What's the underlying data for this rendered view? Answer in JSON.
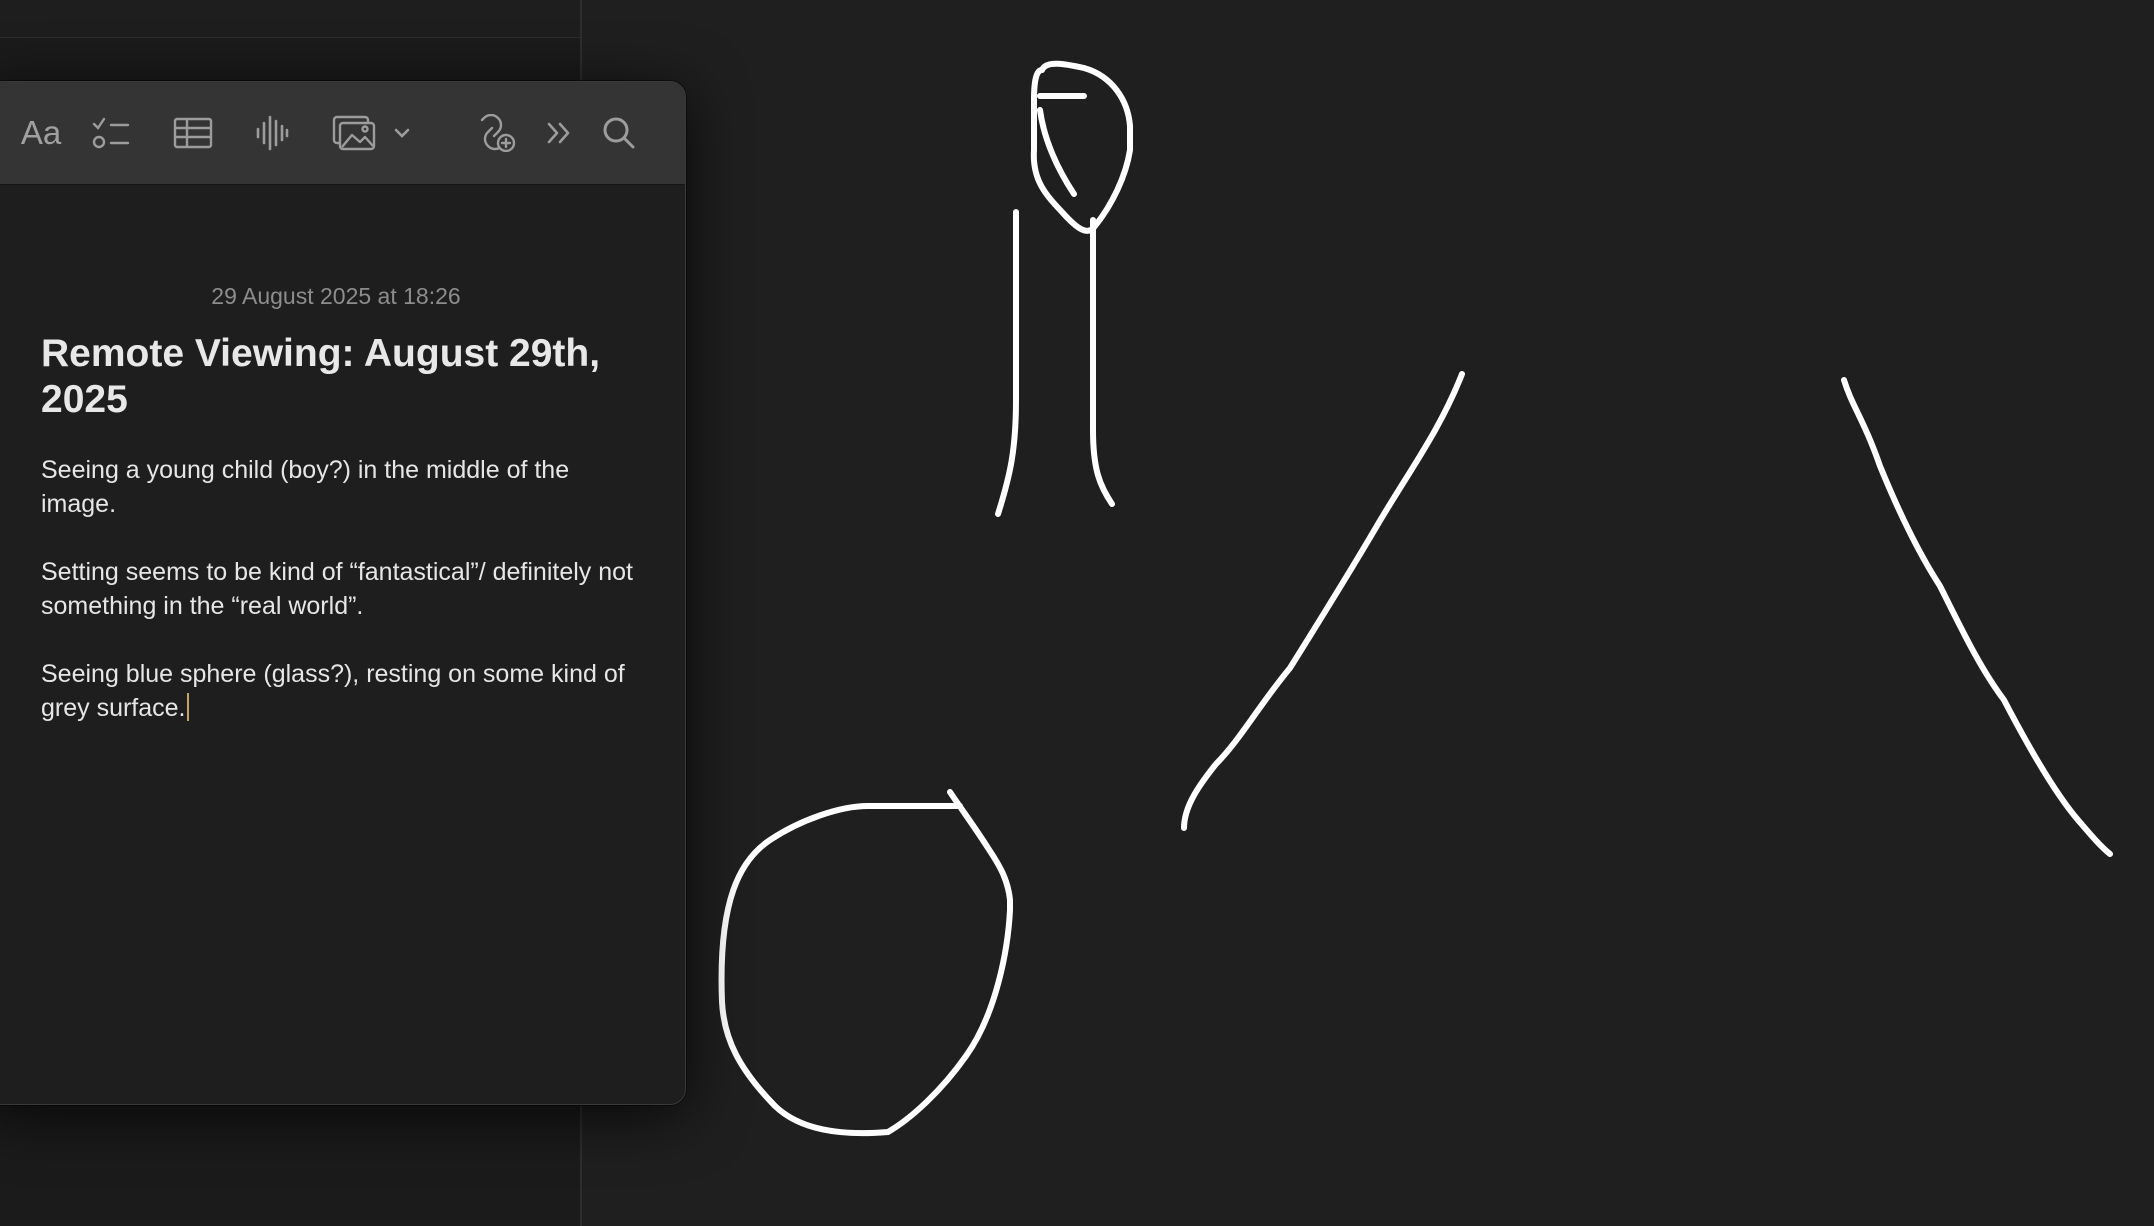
{
  "note": {
    "date": "29 August 2025 at 18:26",
    "title": "Remote Viewing: August 29th, 2025",
    "paragraphs": [
      "Seeing a young child (boy?) in the middle of the image.",
      "Setting seems to be kind of “fantastical”/ definitely not something in the “real world”.",
      "Seeing blue sphere (glass?), resting on some kind of grey surface."
    ]
  },
  "toolbar": {
    "format_label": "Aa",
    "buttons": [
      "format-text",
      "checklist-icon",
      "table-icon",
      "audio-waveform-icon",
      "media-icon",
      "chevron-down-icon",
      "collaborate-icon",
      "more-icon",
      "search-icon"
    ]
  },
  "drawing": {
    "strokes": [
      "figure-head",
      "figure-body",
      "sphere",
      "slope-left",
      "slope-right"
    ],
    "stroke_color": "#ffffff"
  },
  "colors": {
    "background": "#1f1f1f",
    "window": "#1e1e1e",
    "toolbar": "#343434",
    "caret": "#c8a464"
  }
}
